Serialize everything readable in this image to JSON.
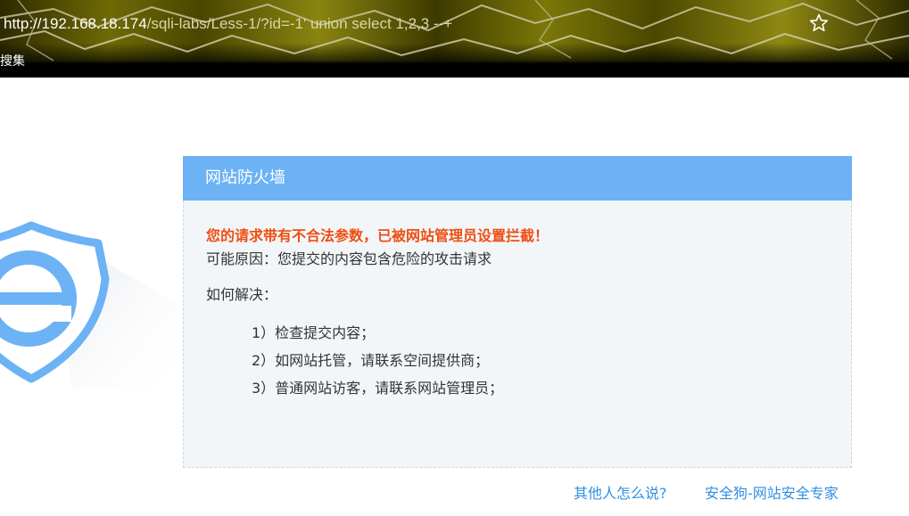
{
  "browser": {
    "url_host": "http://192.168.18.174",
    "url_rest": "/sqli-labs/Less-1/?id=-1' union select 1,2,3 --+",
    "bookmark": "搜集",
    "star_icon": "star-outline-icon"
  },
  "firewall": {
    "title": "网站防火墙",
    "warning": "您的请求带有不合法参数，已被网站管理员设置拦截！",
    "reason": "可能原因：您提交的内容包含危险的攻击请求",
    "how_label": "如何解决：",
    "steps": [
      "1）检查提交内容；",
      "2）如网站托管，请联系空间提供商；",
      "3）普通网站访客，请联系网站管理员；"
    ],
    "logo_icon": "shield-e-icon"
  },
  "footer": {
    "others_link": "其他人怎么说?",
    "brand_link": "安全狗-网站安全专家"
  },
  "colors": {
    "header_blue": "#6cb2f5",
    "warning_red": "#ee4e11",
    "link_blue": "#2f8fe0"
  }
}
